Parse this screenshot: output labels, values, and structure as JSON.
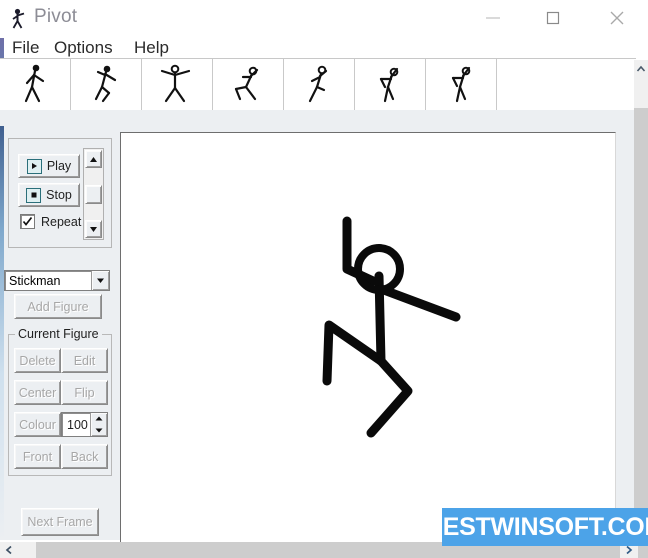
{
  "window": {
    "title": "Pivot",
    "app_icon": "stickman-icon",
    "controls": {
      "minimize": "minimize-icon",
      "maximize": "maximize-icon",
      "close": "close-icon"
    }
  },
  "menubar": {
    "items": [
      {
        "label": "File"
      },
      {
        "label": "Options"
      },
      {
        "label": "Help"
      }
    ]
  },
  "frame_strip": {
    "frames": [
      {
        "index": "1",
        "pose": "standing-walk"
      },
      {
        "index": "2",
        "pose": "leg-raised-lean"
      },
      {
        "index": "3",
        "pose": "arms-out-stride"
      },
      {
        "index": "4",
        "pose": "crouch-lunge"
      },
      {
        "index": "5",
        "pose": "knee-up-kick"
      },
      {
        "index": "6",
        "pose": "bent-over-twist"
      },
      {
        "index": "7",
        "pose": "bent-over-reach"
      }
    ]
  },
  "playback": {
    "play_label": "Play",
    "play_icon": "play-icon",
    "stop_label": "Stop",
    "stop_icon": "stop-icon",
    "repeat_label": "Repeat",
    "repeat_checked": true,
    "scrollbar": "speed-scrollbar"
  },
  "figure_select": {
    "value": "Stickman",
    "arrow_icon": "chevron-down-icon",
    "add_figure_label": "Add Figure",
    "add_figure_disabled": true
  },
  "current_figure": {
    "group_label": "Current Figure",
    "buttons": [
      {
        "label": "Delete",
        "disabled": true
      },
      {
        "label": "Edit",
        "disabled": true
      },
      {
        "label": "Center",
        "disabled": true
      },
      {
        "label": "Flip",
        "disabled": true
      },
      {
        "label": "Colour",
        "disabled": true
      },
      {
        "label": "Front",
        "disabled": true
      },
      {
        "label": "Back",
        "disabled": true
      }
    ],
    "colour_value": "100"
  },
  "frame_controls": {
    "next_frame_label": "Next Frame",
    "next_frame_disabled": true
  },
  "canvas": {
    "background": "#ffffff",
    "figure_color": "#0a0a0a"
  },
  "scrollbars": {
    "right_up_icon": "chevron-up-icon",
    "right_down_icon": "chevron-down-icon",
    "bottom_left_icon": "chevron-left-icon",
    "bottom_right_icon": "chevron-right-icon"
  },
  "watermark": {
    "text": "BESTWINSOFT.COM",
    "background": "#4ca3e8",
    "color": "#ffffff"
  }
}
